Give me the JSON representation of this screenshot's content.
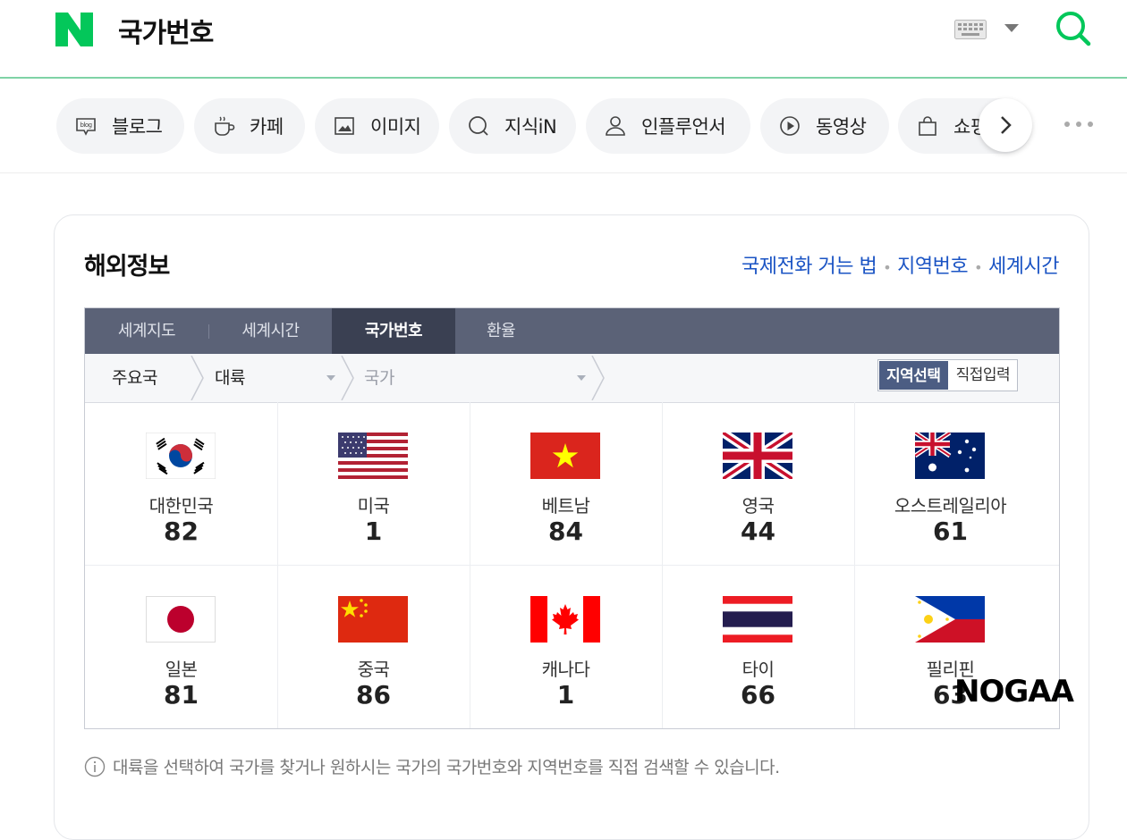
{
  "header": {
    "logo_letter": "N",
    "query": "국가번호",
    "brand_color": "#03c75a"
  },
  "tabs": [
    {
      "label": "블로그",
      "icon": "blog-icon"
    },
    {
      "label": "카페",
      "icon": "cafe-icon"
    },
    {
      "label": "이미지",
      "icon": "image-icon"
    },
    {
      "label": "지식iN",
      "icon": "kin-icon"
    },
    {
      "label": "인플루언서",
      "icon": "person-icon"
    },
    {
      "label": "동영상",
      "icon": "play-icon"
    },
    {
      "label": "쇼핑",
      "icon": "shopping-bag-icon"
    }
  ],
  "card": {
    "title": "해외정보",
    "links": [
      "국제전화 거는 법",
      "지역번호",
      "세계시간"
    ]
  },
  "widget": {
    "nav_tabs": [
      {
        "label": "세계지도",
        "active": false
      },
      {
        "label": "세계시간",
        "active": false
      },
      {
        "label": "국가번호",
        "active": true
      },
      {
        "label": "환율",
        "active": false
      }
    ],
    "crumbs": {
      "major": "주요국",
      "continent": "대륙",
      "country": "국가"
    },
    "toggle": {
      "region_select": "지역선택",
      "direct_input": "직접입력"
    },
    "countries": [
      {
        "name": "대한민국",
        "code": "82",
        "flag": "korea-flag-icon"
      },
      {
        "name": "미국",
        "code": "1",
        "flag": "usa-flag-icon"
      },
      {
        "name": "베트남",
        "code": "84",
        "flag": "vietnam-flag-icon"
      },
      {
        "name": "영국",
        "code": "44",
        "flag": "uk-flag-icon"
      },
      {
        "name": "오스트레일리아",
        "code": "61",
        "flag": "australia-flag-icon"
      },
      {
        "name": "일본",
        "code": "81",
        "flag": "japan-flag-icon"
      },
      {
        "name": "중국",
        "code": "86",
        "flag": "china-flag-icon"
      },
      {
        "name": "캐나다",
        "code": "1",
        "flag": "canada-flag-icon"
      },
      {
        "name": "타이",
        "code": "66",
        "flag": "thailand-flag-icon"
      },
      {
        "name": "필리핀",
        "code": "63",
        "flag": "philippines-flag-icon"
      }
    ]
  },
  "notice": "대륙을 선택하여 국가를 찾거나 원하시는 국가의 국가번호와 지역번호를 직접 검색할 수 있습니다.",
  "watermark": "NOGAA"
}
